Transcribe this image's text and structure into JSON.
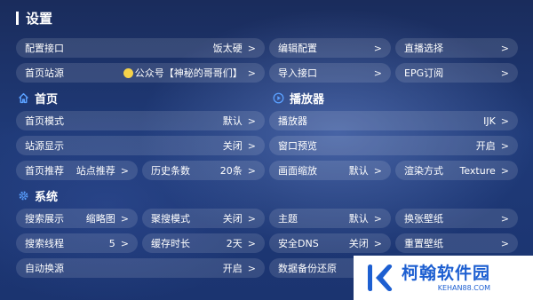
{
  "title": "设置",
  "chevron": ">",
  "sections": {
    "home": "首页",
    "player": "播放器",
    "system": "系统"
  },
  "config": {
    "port": {
      "label": "配置接口",
      "value": "饭太硬"
    },
    "edit": {
      "label": "编辑配置"
    },
    "live": {
      "label": "直播选择"
    },
    "source": {
      "label": "首页站源",
      "value": "公众号【神秘的哥哥们】"
    },
    "import": {
      "label": "导入接口"
    },
    "epg": {
      "label": "EPG订阅"
    }
  },
  "home": {
    "mode": {
      "label": "首页模式",
      "value": "默认"
    },
    "site_display": {
      "label": "站源显示",
      "value": "关闭"
    },
    "recommend": {
      "label": "首页推荐",
      "value": "站点推荐"
    },
    "history": {
      "label": "历史条数",
      "value": "20条"
    }
  },
  "player": {
    "player": {
      "label": "播放器",
      "value": "IJK"
    },
    "preview": {
      "label": "窗口预览",
      "value": "开启"
    },
    "zoom": {
      "label": "画面缩放",
      "value": "默认"
    },
    "render": {
      "label": "渲染方式",
      "value": "Texture"
    }
  },
  "system": {
    "search_display": {
      "label": "搜索展示",
      "value": "缩略图"
    },
    "aggregate": {
      "label": "聚搜模式",
      "value": "关闭"
    },
    "theme": {
      "label": "主题",
      "value": "默认"
    },
    "wallpaper_change": {
      "label": "换张壁纸"
    },
    "threads": {
      "label": "搜索线程",
      "value": "5"
    },
    "cache": {
      "label": "缓存时长",
      "value": "2天"
    },
    "dns": {
      "label": "安全DNS",
      "value": "关闭"
    },
    "wallpaper_reset": {
      "label": "重置壁纸"
    },
    "auto_switch": {
      "label": "自动换源",
      "value": "开启"
    },
    "backup": {
      "label": "数据备份还原"
    }
  },
  "watermark": {
    "name": "柯翰软件园",
    "url": "KEHAN88.COM"
  },
  "colors": {
    "background": "#1f3a78",
    "accent": "#5aa0ff",
    "watermark": "#1d5fd1"
  }
}
